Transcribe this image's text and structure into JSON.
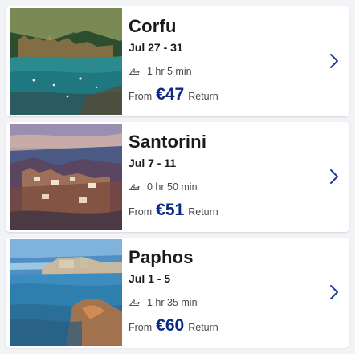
{
  "colors": {
    "price": "#0a2a86",
    "chevron": "#1f3a93",
    "background": "#f1f3f6",
    "card": "#ffffff"
  },
  "flights": [
    {
      "destination": "Corfu",
      "dates": "Jul 27 - 31",
      "duration": "1 hr 5 min",
      "from_label": "From",
      "price": "€47",
      "return_label": "Return",
      "image": "Corfu coastal town with turquoise sea"
    },
    {
      "destination": "Santorini",
      "dates": "Jul 7 - 11",
      "duration": "0 hr 50 min",
      "from_label": "From",
      "price": "€51",
      "return_label": "Return",
      "image": "Santorini cliffside village at sunset"
    },
    {
      "destination": "Paphos",
      "dates": "Jul 1 - 5",
      "duration": "1 hr 35 min",
      "from_label": "From",
      "price": "€60",
      "return_label": "Return",
      "image": "Paphos harbour with blue sea and sky"
    }
  ],
  "icons": {
    "plane": "plane-icon",
    "chevron": "chevron-right-icon"
  }
}
